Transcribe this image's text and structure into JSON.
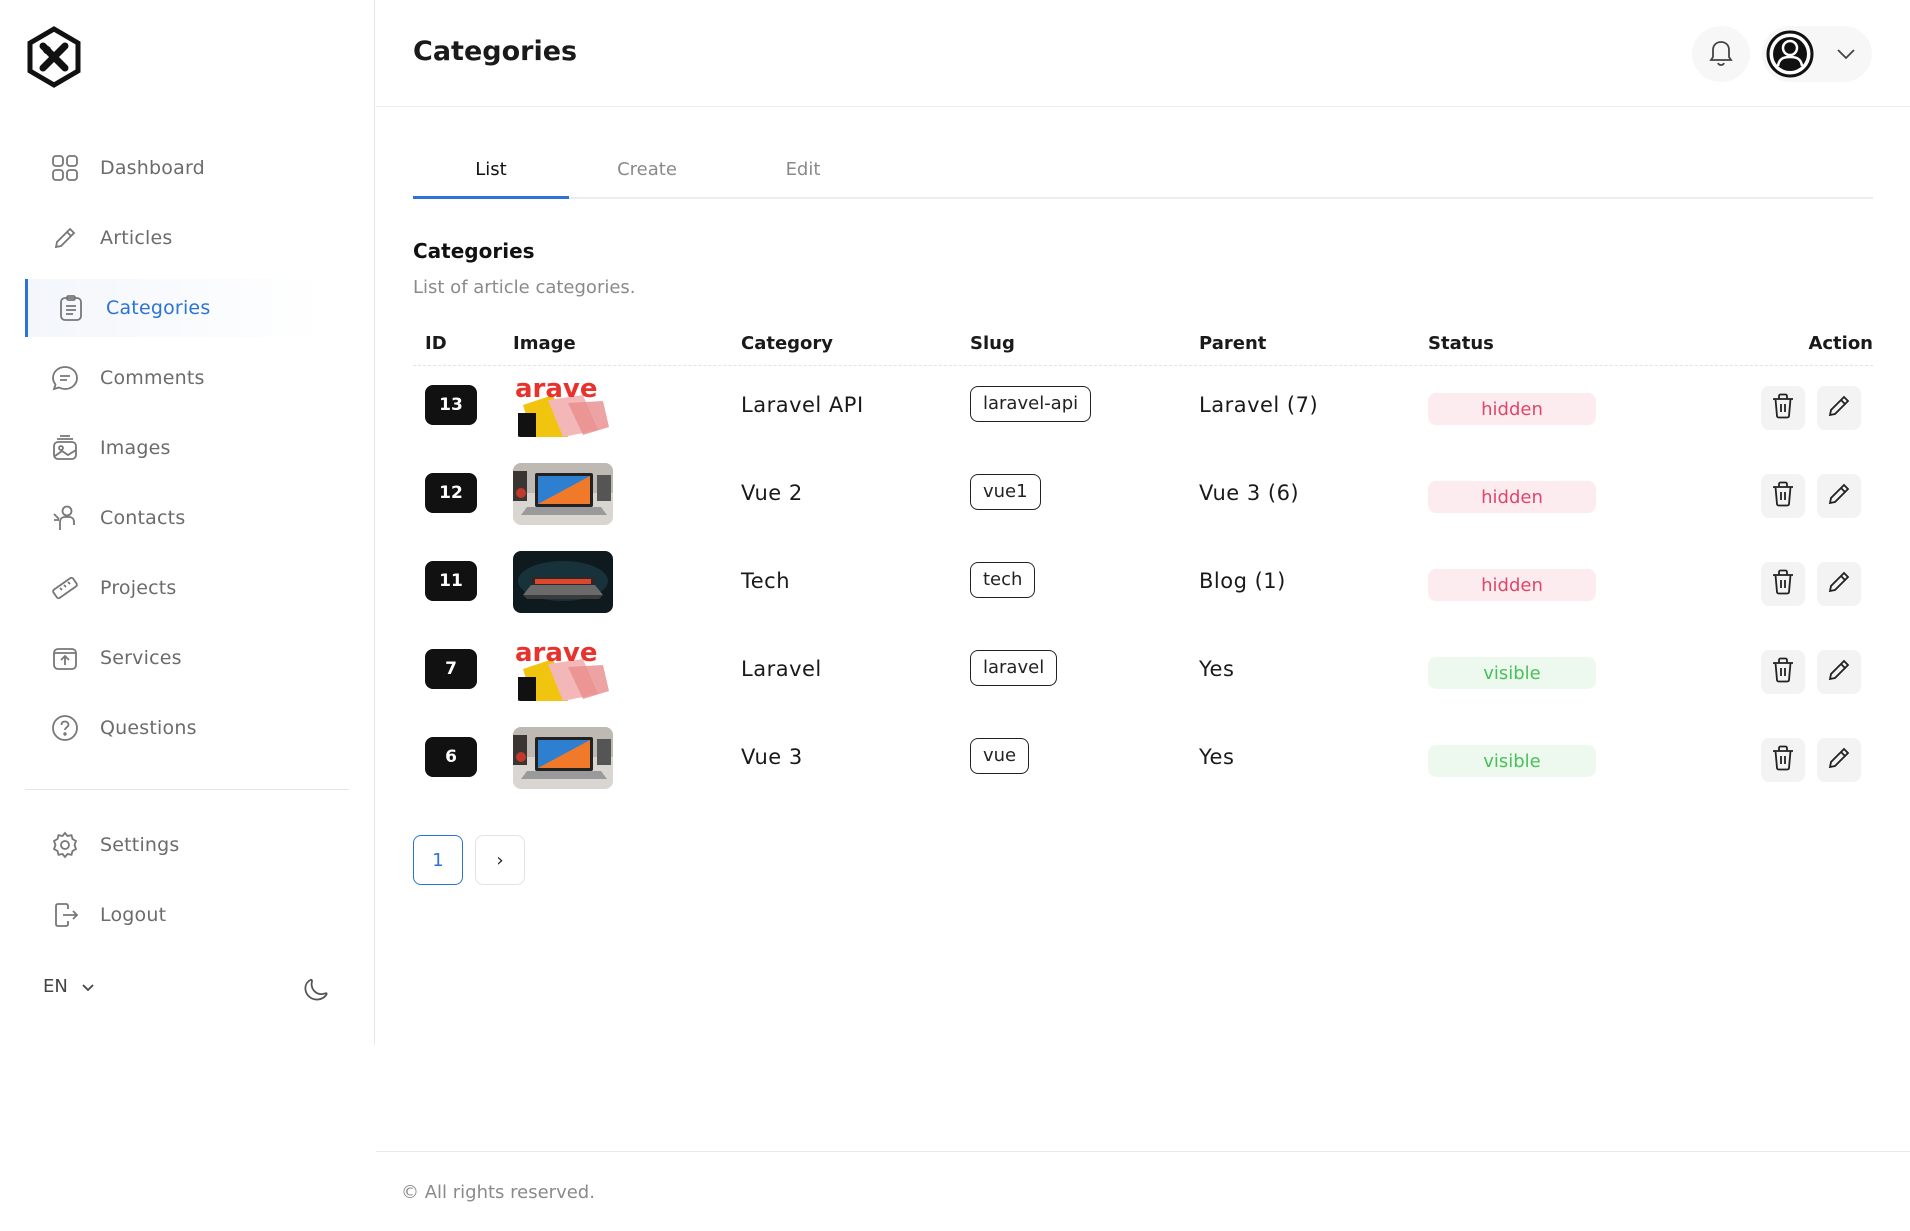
{
  "sidebar": {
    "items": [
      {
        "label": "Dashboard",
        "icon": "grid-icon"
      },
      {
        "label": "Articles",
        "icon": "pencil-icon"
      },
      {
        "label": "Categories",
        "icon": "clipboard-list-icon",
        "active": true
      },
      {
        "label": "Comments",
        "icon": "chat-bubble-icon"
      },
      {
        "label": "Images",
        "icon": "image-stack-icon"
      },
      {
        "label": "Contacts",
        "icon": "person-icon"
      },
      {
        "label": "Projects",
        "icon": "ruler-icon"
      },
      {
        "label": "Services",
        "icon": "upload-box-icon"
      },
      {
        "label": "Questions",
        "icon": "question-circle-icon"
      }
    ],
    "bottom_items": [
      {
        "label": "Settings",
        "icon": "gear-icon"
      },
      {
        "label": "Logout",
        "icon": "logout-icon"
      }
    ],
    "language": "EN"
  },
  "header": {
    "title": "Categories"
  },
  "tabs": [
    {
      "label": "List",
      "active": true
    },
    {
      "label": "Create"
    },
    {
      "label": "Edit"
    }
  ],
  "section": {
    "title": "Categories",
    "subtitle": "List of article categories."
  },
  "table": {
    "columns": [
      "ID",
      "Image",
      "Category",
      "Slug",
      "Parent",
      "Status",
      "Action"
    ],
    "rows": [
      {
        "id": "13",
        "image": "laravel-banner",
        "category": "Laravel API",
        "slug": "laravel-api",
        "parent": "Laravel (7)",
        "status": "hidden"
      },
      {
        "id": "12",
        "image": "laptop-desk",
        "category": "Vue 2",
        "slug": "vue1",
        "parent": "Vue 3 (6)",
        "status": "hidden"
      },
      {
        "id": "11",
        "image": "laptop-dark",
        "category": "Tech",
        "slug": "tech",
        "parent": "Blog (1)",
        "status": "hidden"
      },
      {
        "id": "7",
        "image": "laravel-banner",
        "category": "Laravel",
        "slug": "laravel",
        "parent": "Yes",
        "status": "visible"
      },
      {
        "id": "6",
        "image": "laptop-desk",
        "category": "Vue 3",
        "slug": "vue",
        "parent": "Yes",
        "status": "visible"
      }
    ]
  },
  "pagination": {
    "current": "1",
    "next": "›"
  },
  "footer": {
    "text": "© All rights reserved."
  },
  "colors": {
    "accent": "#2b73d6",
    "hidden": "#e0456a",
    "visible": "#49c159"
  }
}
